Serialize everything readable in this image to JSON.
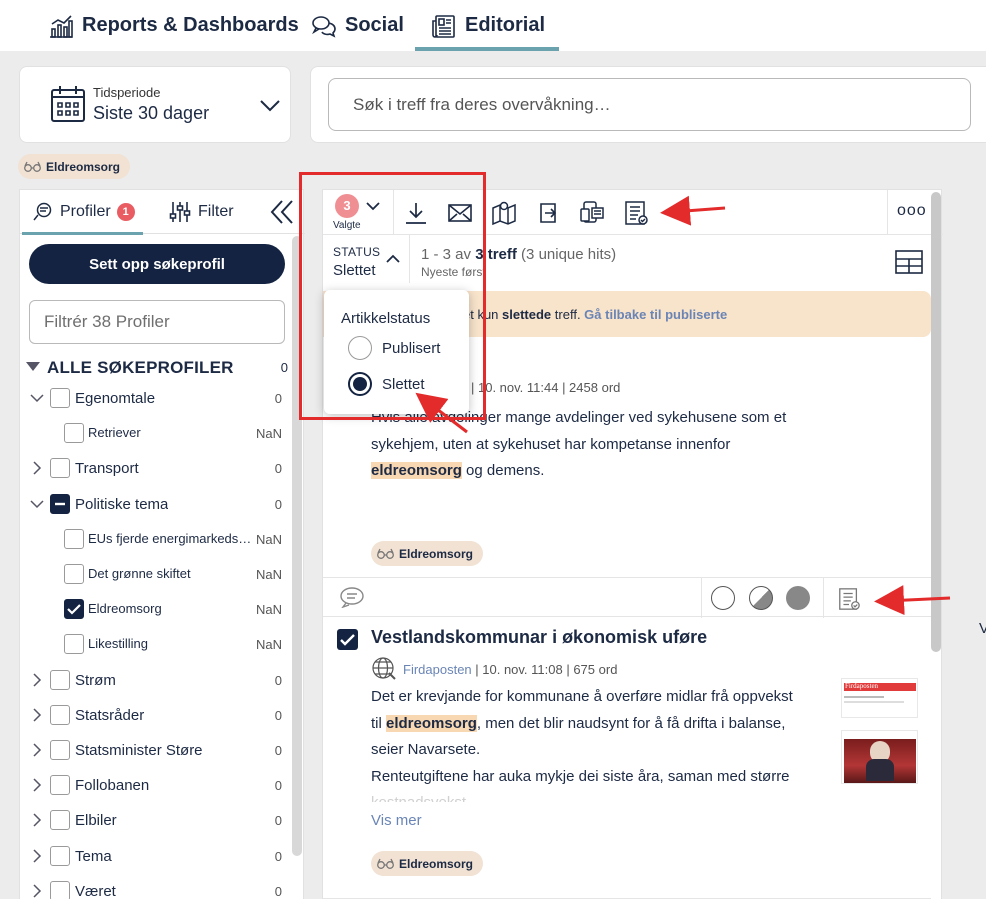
{
  "nav": {
    "tabs": [
      {
        "label": "Reports & Dashboards",
        "active": false
      },
      {
        "label": "Social",
        "active": false
      },
      {
        "label": "Editorial",
        "active": true
      }
    ],
    "accent_color": "#6aa2ad"
  },
  "period": {
    "label": "Tidsperiode",
    "value": "Siste 30 dager"
  },
  "search": {
    "placeholder": "Søk i treff fra deres overvåkning…"
  },
  "active_chip": "Eldreomsorg",
  "left_panel": {
    "tab_profiles": "Profiler",
    "profiles_badge": "1",
    "tab_filter": "Filter",
    "setup_button": "Sett opp søkeprofil",
    "filter_placeholder": "Filtrér 38 Profiler",
    "all_header": "ALLE SØKEPROFILER",
    "all_count": "0",
    "items": [
      {
        "label": "Egenomtale",
        "count": "0",
        "level": 0,
        "expand": "open",
        "state": "unchecked"
      },
      {
        "label": "Retriever",
        "count": "NaN",
        "level": 1,
        "state": "unchecked"
      },
      {
        "label": "Transport",
        "count": "0",
        "level": 0,
        "expand": "closed",
        "state": "unchecked"
      },
      {
        "label": "Politiske tema",
        "count": "0",
        "level": 0,
        "expand": "open",
        "state": "mixed"
      },
      {
        "label": "EUs fjerde energimarkeds…",
        "count": "NaN",
        "level": 1,
        "state": "unchecked"
      },
      {
        "label": "Det grønne skiftet",
        "count": "NaN",
        "level": 1,
        "state": "unchecked"
      },
      {
        "label": "Eldreomsorg",
        "count": "NaN",
        "level": 1,
        "state": "checked"
      },
      {
        "label": "Likestilling",
        "count": "NaN",
        "level": 1,
        "state": "unchecked"
      },
      {
        "label": "Strøm",
        "count": "0",
        "level": 0,
        "expand": "closed",
        "state": "unchecked"
      },
      {
        "label": "Statsråder",
        "count": "0",
        "level": 0,
        "expand": "closed",
        "state": "unchecked"
      },
      {
        "label": "Statsminister Støre",
        "count": "0",
        "level": 0,
        "expand": "closed",
        "state": "unchecked"
      },
      {
        "label": "Follobanen",
        "count": "0",
        "level": 0,
        "expand": "closed",
        "state": "unchecked"
      },
      {
        "label": "Elbiler",
        "count": "0",
        "level": 0,
        "expand": "closed",
        "state": "unchecked"
      },
      {
        "label": "Tema",
        "count": "0",
        "level": 0,
        "expand": "closed",
        "state": "unchecked"
      },
      {
        "label": "Været",
        "count": "0",
        "level": 0,
        "expand": "closed",
        "state": "unchecked"
      }
    ]
  },
  "toolbar": {
    "selected_count": "3",
    "selected_label": "Valgte",
    "status_label": "STATUS",
    "status_value": "Slettet",
    "count_prefix": "1 - 3 av ",
    "count_bold": "3 treff",
    "count_suffix": " (3 unique hits)",
    "sort": "Nyeste først",
    "more": "ooo"
  },
  "notice": {
    "text_before": "et kun ",
    "text_bold": "slettede",
    "text_after": " treff. ",
    "link": "Gå tilbake til publiserte"
  },
  "popup": {
    "title": "Artikkelstatus",
    "options": [
      {
        "label": "Publisert",
        "selected": false
      },
      {
        "label": "Slettet",
        "selected": true
      }
    ]
  },
  "article1": {
    "meta": "|  10. nov. 11:44  |  2458 ord",
    "line1": "Hvis alle avdelinger mange avdelinger ved sykehusene som et",
    "line2": "sykehjem, uten at sykehuset har kompetanse innenfor",
    "line3_hl": "eldreomsorg",
    "line3_rest": " og demens.",
    "chip": "Eldreomsorg"
  },
  "article2": {
    "title": "Vestlandskommunar i økonomisk uføre",
    "source": "Firdaposten",
    "meta": "  |  10. nov. 11:08  |  675 ord",
    "line1": "Det er krevjande for kommunane å overføre midlar frå oppvekst",
    "line2_pre": "til ",
    "line2_hl": "eldreomsorg",
    "line2_rest": ", men det blir naudsynt for å få drifta i balanse,",
    "line3": "seier Navarsete.",
    "line4": "Renteutgiftene har auka mykje dei siste åra, saman med større",
    "line5": "kostnadsvekst",
    "more": "Vis mer",
    "chip": "Eldreomsorg",
    "thumb_label": "Firdaposten"
  },
  "edge_text": "V",
  "icons": [
    "bar-chart-icon",
    "chat-bubbles-icon",
    "newspaper-icon",
    "calendar-icon",
    "chevron-down-icon",
    "search-icon",
    "glasses-icon",
    "sliders-icon",
    "double-chevron-left-icon",
    "download-icon",
    "mail-icon",
    "map-book-icon",
    "export-icon",
    "devices-icon",
    "report-check-icon",
    "layout-grid-icon",
    "comment-icon",
    "globe-icon"
  ],
  "colors": {
    "navy": "#132341",
    "chip_bg": "#f1e2d3",
    "highlight": "#f8d8b3",
    "notice_bg": "#f8e3cb",
    "annotation_red": "#e32b2b",
    "link": "#6a85b5"
  }
}
